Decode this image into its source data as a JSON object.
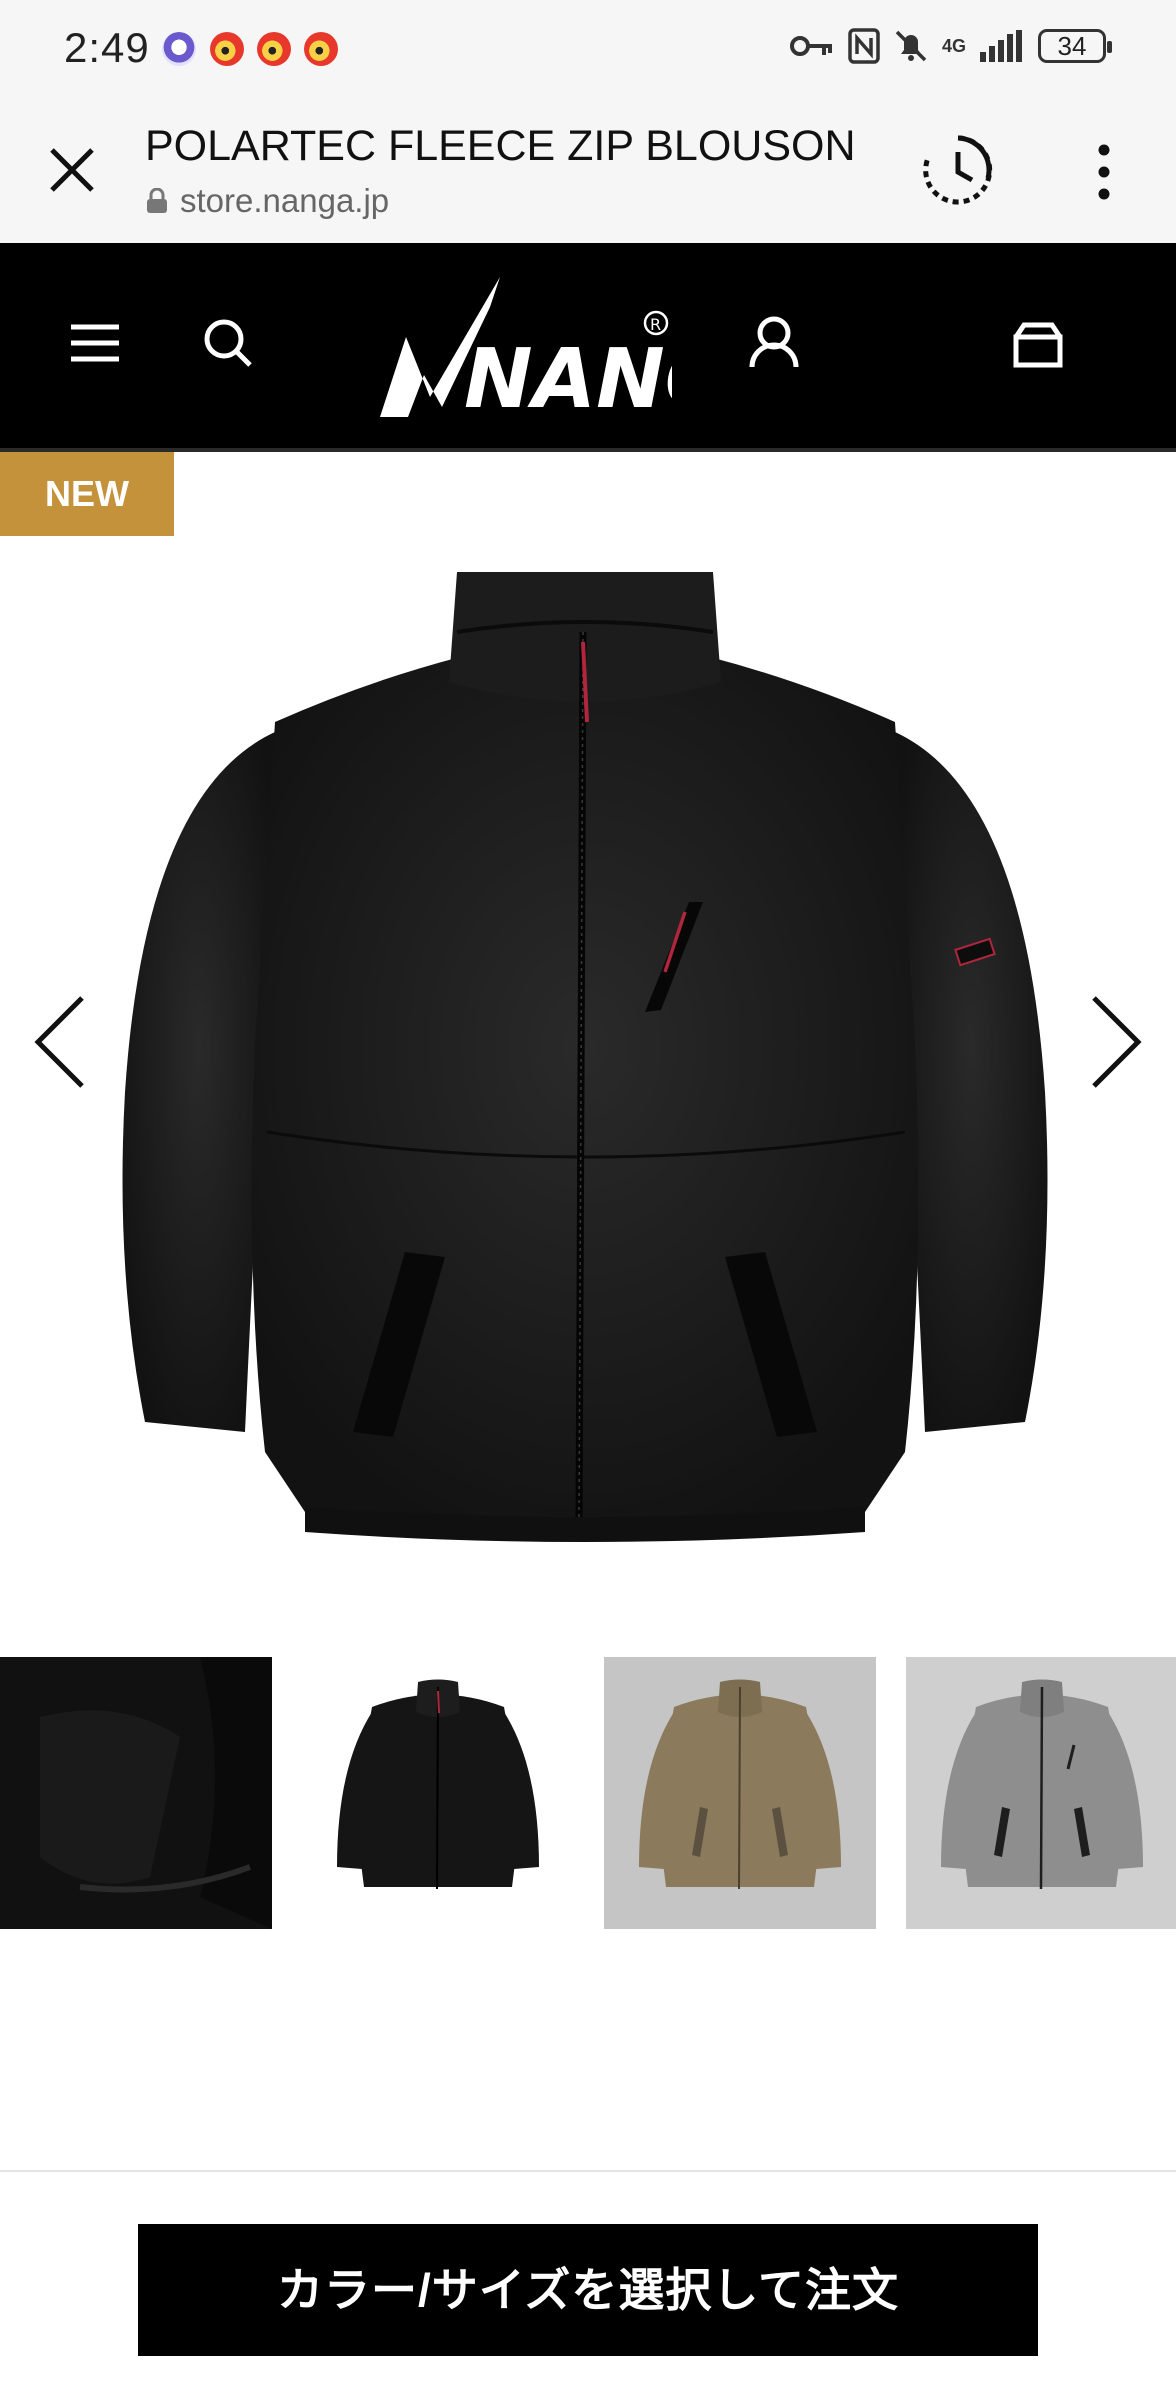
{
  "status_bar": {
    "time": "2:49",
    "network": "4G",
    "battery": "34"
  },
  "browser": {
    "title": "POLARTEC FLEECE ZIP BLOUSON",
    "url": "store.nanga.jp"
  },
  "site_header": {
    "brand": "NANGA",
    "icons": [
      "menu-icon",
      "search-icon",
      "account-icon",
      "cart-icon"
    ]
  },
  "product": {
    "badge": "NEW",
    "badge_color": "#c4923b",
    "thumbnails": [
      {
        "color": "#0a0a0a",
        "label": "detail"
      },
      {
        "color": "#151515",
        "label": "black"
      },
      {
        "color": "#8b7a5c",
        "label": "coyote"
      },
      {
        "color": "#8e8e8e",
        "label": "gray"
      }
    ]
  },
  "cta": {
    "label": "カラー/サイズを選択して注文"
  }
}
